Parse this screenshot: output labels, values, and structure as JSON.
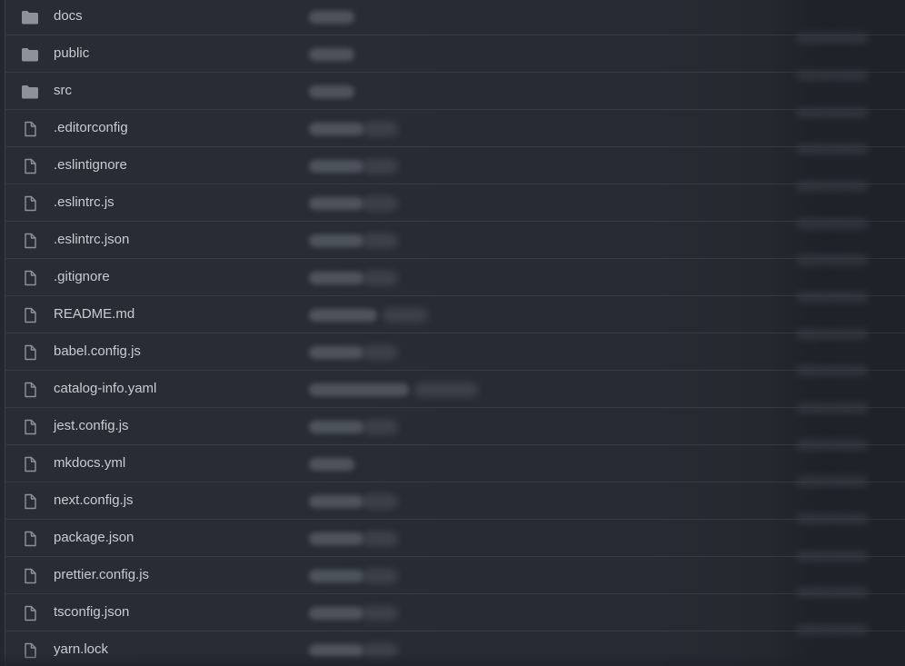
{
  "colors": {
    "background": "#1e232b",
    "row_background": "#282d35",
    "row_border": "#353c46",
    "text": "#c7ccd3",
    "icon": "#8b929c"
  },
  "files": [
    {
      "name": "docs",
      "type": "folder",
      "icon": "folder-icon"
    },
    {
      "name": "public",
      "type": "folder",
      "icon": "folder-icon"
    },
    {
      "name": "src",
      "type": "folder",
      "icon": "folder-icon"
    },
    {
      "name": ".editorconfig",
      "type": "file",
      "icon": "file-icon"
    },
    {
      "name": ".eslintignore",
      "type": "file",
      "icon": "file-icon"
    },
    {
      "name": ".eslintrc.js",
      "type": "file",
      "icon": "file-icon"
    },
    {
      "name": ".eslintrc.json",
      "type": "file",
      "icon": "file-icon"
    },
    {
      "name": ".gitignore",
      "type": "file",
      "icon": "file-icon"
    },
    {
      "name": "README.md",
      "type": "file",
      "icon": "file-icon"
    },
    {
      "name": "babel.config.js",
      "type": "file",
      "icon": "file-icon"
    },
    {
      "name": "catalog-info.yaml",
      "type": "file",
      "icon": "file-icon"
    },
    {
      "name": "jest.config.js",
      "type": "file",
      "icon": "file-icon"
    },
    {
      "name": "mkdocs.yml",
      "type": "file",
      "icon": "file-icon"
    },
    {
      "name": "next.config.js",
      "type": "file",
      "icon": "file-icon"
    },
    {
      "name": "package.json",
      "type": "file",
      "icon": "file-icon"
    },
    {
      "name": "prettier.config.js",
      "type": "file",
      "icon": "file-icon"
    },
    {
      "name": "tsconfig.json",
      "type": "file",
      "icon": "file-icon"
    },
    {
      "name": "yarn.lock",
      "type": "file",
      "icon": "file-icon"
    }
  ]
}
